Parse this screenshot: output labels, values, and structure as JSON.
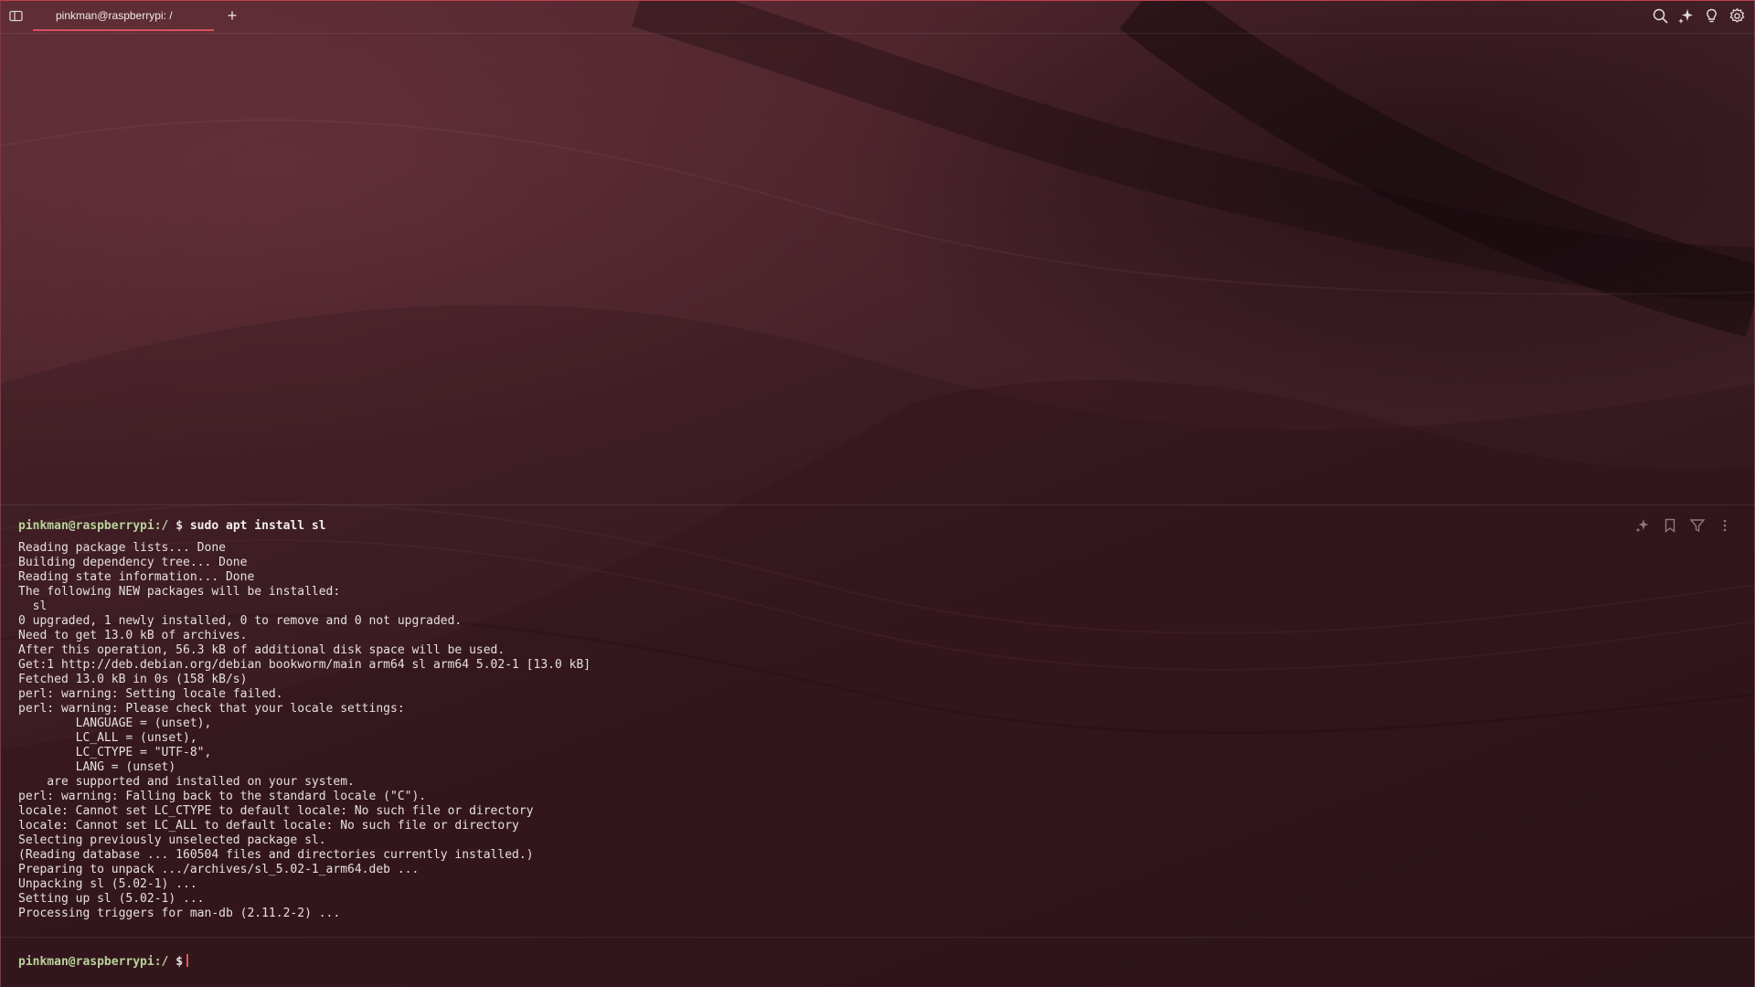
{
  "tab": {
    "title": "pinkman@raspberrypi: /",
    "new_tab": "+"
  },
  "toolbar": {
    "icons": [
      "search-icon",
      "ai-sparkle-icon",
      "lightbulb-icon",
      "settings-gear-icon"
    ]
  },
  "block": {
    "prompt": "pinkman@raspberrypi:/",
    "dollar": "$",
    "command": "sudo apt install sl",
    "output": "Reading package lists... Done\nBuilding dependency tree... Done\nReading state information... Done\nThe following NEW packages will be installed:\n  sl\n0 upgraded, 1 newly installed, 0 to remove and 0 not upgraded.\nNeed to get 13.0 kB of archives.\nAfter this operation, 56.3 kB of additional disk space will be used.\nGet:1 http://deb.debian.org/debian bookworm/main arm64 sl arm64 5.02-1 [13.0 kB]\nFetched 13.0 kB in 0s (158 kB/s)\nperl: warning: Setting locale failed.\nperl: warning: Please check that your locale settings:\n        LANGUAGE = (unset),\n        LC_ALL = (unset),\n        LC_CTYPE = \"UTF-8\",\n        LANG = (unset)\n    are supported and installed on your system.\nperl: warning: Falling back to the standard locale (\"C\").\nlocale: Cannot set LC_CTYPE to default locale: No such file or directory\nlocale: Cannot set LC_ALL to default locale: No such file or directory\nSelecting previously unselected package sl.\n(Reading database ... 160504 files and directories currently installed.)\nPreparing to unpack .../archives/sl_5.02-1_arm64.deb ...\nUnpacking sl (5.02-1) ...\nSetting up sl (5.02-1) ...\nProcessing triggers for man-db (2.11.2-2) ...",
    "actions": [
      "ai-sparkle-icon",
      "bookmark-icon",
      "filter-icon",
      "more-vertical-icon"
    ]
  },
  "input": {
    "prompt": "pinkman@raspberrypi:/",
    "dollar": "$"
  },
  "colors": {
    "accent": "#d7505e",
    "prompt_user": "#b8d49a",
    "background": "#3a1c22"
  }
}
